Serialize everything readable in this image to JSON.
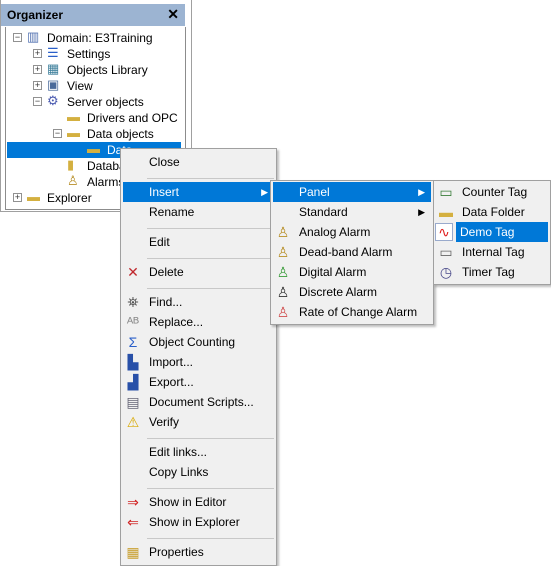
{
  "organizer": {
    "title": "Organizer",
    "close": "✕",
    "tree": [
      {
        "label": "Domain: E3Training",
        "icon": "domain-icon",
        "expander": "−"
      },
      {
        "label": "Settings",
        "icon": "settings-icon",
        "expander": "+"
      },
      {
        "label": "Objects Library",
        "icon": "library-icon",
        "expander": "+"
      },
      {
        "label": "View",
        "icon": "monitor-icon",
        "expander": "+"
      },
      {
        "label": "Server objects",
        "icon": "gears-icon",
        "expander": "−"
      },
      {
        "label": "Drivers and OPC",
        "icon": "drivers-folder-icon"
      },
      {
        "label": "Data objects",
        "icon": "data-folder-icon",
        "expander": "−"
      },
      {
        "label": "Data",
        "icon": "data-folder-icon",
        "selected": true
      },
      {
        "label": "Databa",
        "icon": "database-icon"
      },
      {
        "label": "Alarms",
        "icon": "alarm-icon"
      },
      {
        "label": "Explorer",
        "icon": "folder-icon",
        "expander": "+"
      }
    ]
  },
  "context_menu": {
    "items": [
      {
        "label": "Close"
      },
      {
        "label": "Insert",
        "submenu": true,
        "highlighted": true
      },
      {
        "label": "Rename"
      },
      {
        "label": "Edit"
      },
      {
        "label": "Delete",
        "icon": "delete-icon"
      },
      {
        "label": "Find...",
        "icon": "binoculars-icon"
      },
      {
        "label": "Replace...",
        "icon": "replace-icon"
      },
      {
        "label": "Object Counting",
        "icon": "sigma-icon"
      },
      {
        "label": "Import...",
        "icon": "import-icon"
      },
      {
        "label": "Export...",
        "icon": "export-icon"
      },
      {
        "label": "Document Scripts...",
        "icon": "book-icon"
      },
      {
        "label": "Verify",
        "icon": "verify-icon"
      },
      {
        "label": "Edit links..."
      },
      {
        "label": "Copy Links"
      },
      {
        "label": "Show in Editor",
        "icon": "show-editor-icon"
      },
      {
        "label": "Show in Explorer",
        "icon": "show-explorer-icon"
      },
      {
        "label": "Properties",
        "icon": "properties-icon"
      }
    ]
  },
  "insert_submenu": {
    "items": [
      {
        "label": "Panel",
        "submenu": true,
        "highlighted": true
      },
      {
        "label": "Standard",
        "submenu": true
      },
      {
        "label": "Analog Alarm",
        "icon": "analog-alarm-icon"
      },
      {
        "label": "Dead-band Alarm",
        "icon": "deadband-alarm-icon"
      },
      {
        "label": "Digital Alarm",
        "icon": "digital-alarm-icon"
      },
      {
        "label": "Discrete Alarm",
        "icon": "discrete-alarm-icon"
      },
      {
        "label": "Rate of Change Alarm",
        "icon": "rate-alarm-icon"
      }
    ]
  },
  "panel_submenu": {
    "items": [
      {
        "label": "Counter Tag",
        "icon": "counter-tag-icon"
      },
      {
        "label": "Data Folder",
        "icon": "data-folder-icon"
      },
      {
        "label": "Demo Tag",
        "icon": "sine-wave-icon",
        "highlighted": true
      },
      {
        "label": "Internal Tag",
        "icon": "internal-tag-icon"
      },
      {
        "label": "Timer Tag",
        "icon": "clock-icon"
      }
    ]
  },
  "colors": {
    "highlight": "#0078d7",
    "title_bar": "#9cb4d2",
    "menu_bg": "#f0f0f0"
  }
}
